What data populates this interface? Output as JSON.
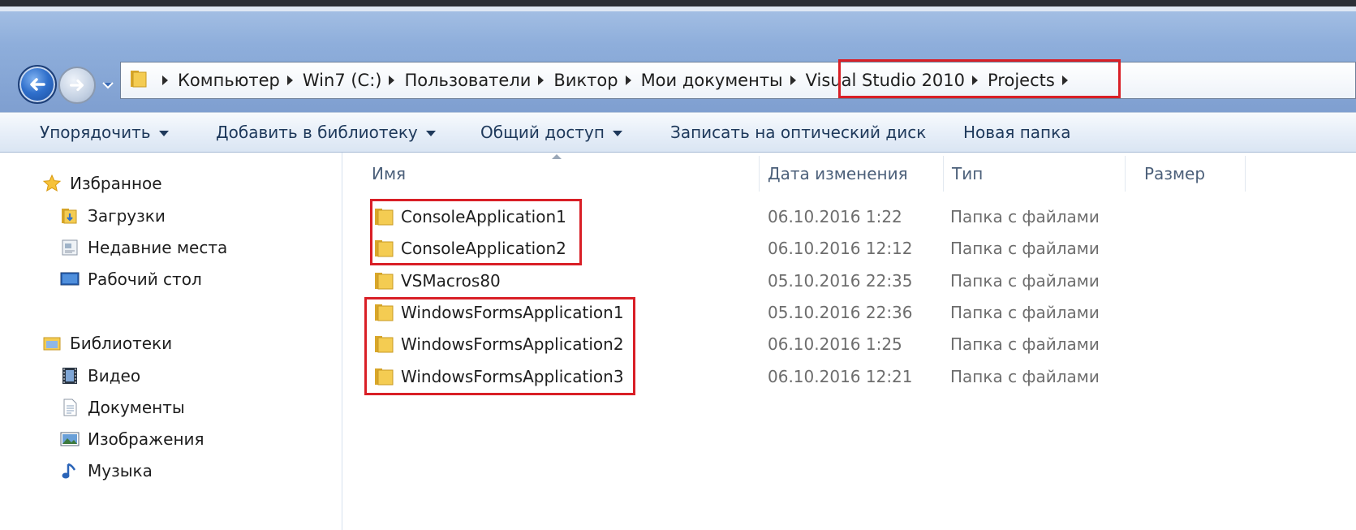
{
  "address_bar": {
    "crumbs": [
      "Компьютер",
      "Win7 (C:)",
      "Пользователи",
      "Виктор",
      "Мои документы",
      "Visual Studio 2010",
      "Projects"
    ]
  },
  "toolbar": {
    "organize": "Упорядочить",
    "add_to_library": "Добавить в библиотеку",
    "share": "Общий доступ",
    "burn": "Записать на оптический диск",
    "new_folder": "Новая папка"
  },
  "nav_pane": {
    "favorites": {
      "label": "Избранное",
      "items": [
        "Загрузки",
        "Недавние места",
        "Рабочий стол"
      ]
    },
    "libraries": {
      "label": "Библиотеки",
      "items": [
        "Видео",
        "Документы",
        "Изображения",
        "Музыка"
      ]
    }
  },
  "columns": {
    "name": "Имя",
    "date": "Дата изменения",
    "type": "Тип",
    "size": "Размер"
  },
  "files": [
    {
      "name": "ConsoleApplication1",
      "date": "06.10.2016 1:22",
      "type": "Папка с файлами"
    },
    {
      "name": "ConsoleApplication2",
      "date": "06.10.2016 12:12",
      "type": "Папка с файлами"
    },
    {
      "name": "VSMacros80",
      "date": "05.10.2016 22:35",
      "type": "Папка с файлами"
    },
    {
      "name": "WindowsFormsApplication1",
      "date": "05.10.2016 22:36",
      "type": "Папка с файлами"
    },
    {
      "name": "WindowsFormsApplication2",
      "date": "06.10.2016 1:25",
      "type": "Папка с файлами"
    },
    {
      "name": "WindowsFormsApplication3",
      "date": "06.10.2016 12:21",
      "type": "Папка с файлами"
    }
  ],
  "colors": {
    "highlight": "#d91f26",
    "toolbar_text": "#1e395b",
    "folder_yellow": "#f2c94c"
  }
}
